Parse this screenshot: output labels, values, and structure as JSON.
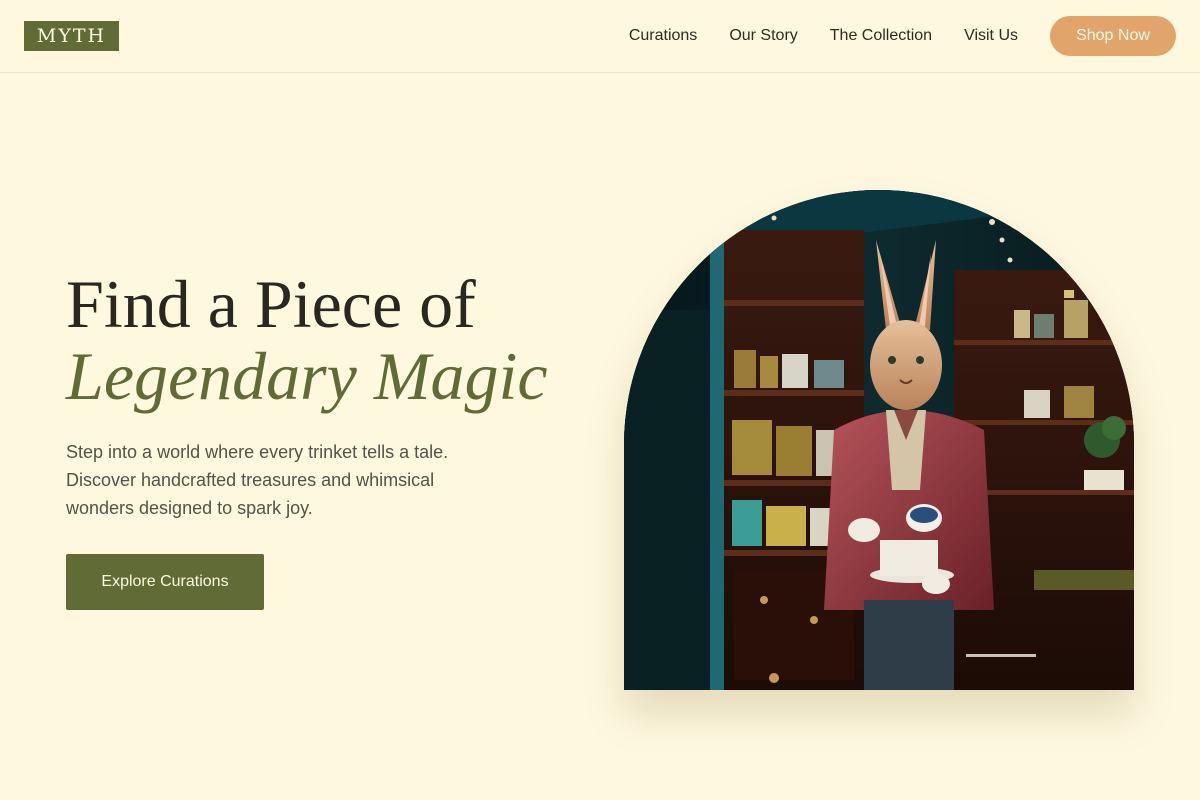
{
  "header": {
    "logo": "MYTH",
    "nav": [
      {
        "label": "Curations"
      },
      {
        "label": "Our Story"
      },
      {
        "label": "The Collection"
      },
      {
        "label": "Visit Us"
      }
    ],
    "shop_label": "Shop Now"
  },
  "hero": {
    "title_line1": "Find a Piece of",
    "title_line2": "Legendary Magic",
    "subtitle": "Step into a world where every trinket tells a tale. Discover handcrafted treasures and whimsical wonders designed to spark joy.",
    "cta_label": "Explore Curations"
  },
  "colors": {
    "background": "#fef8df",
    "accent_olive": "#606b35",
    "accent_orange": "#e1a46a"
  }
}
